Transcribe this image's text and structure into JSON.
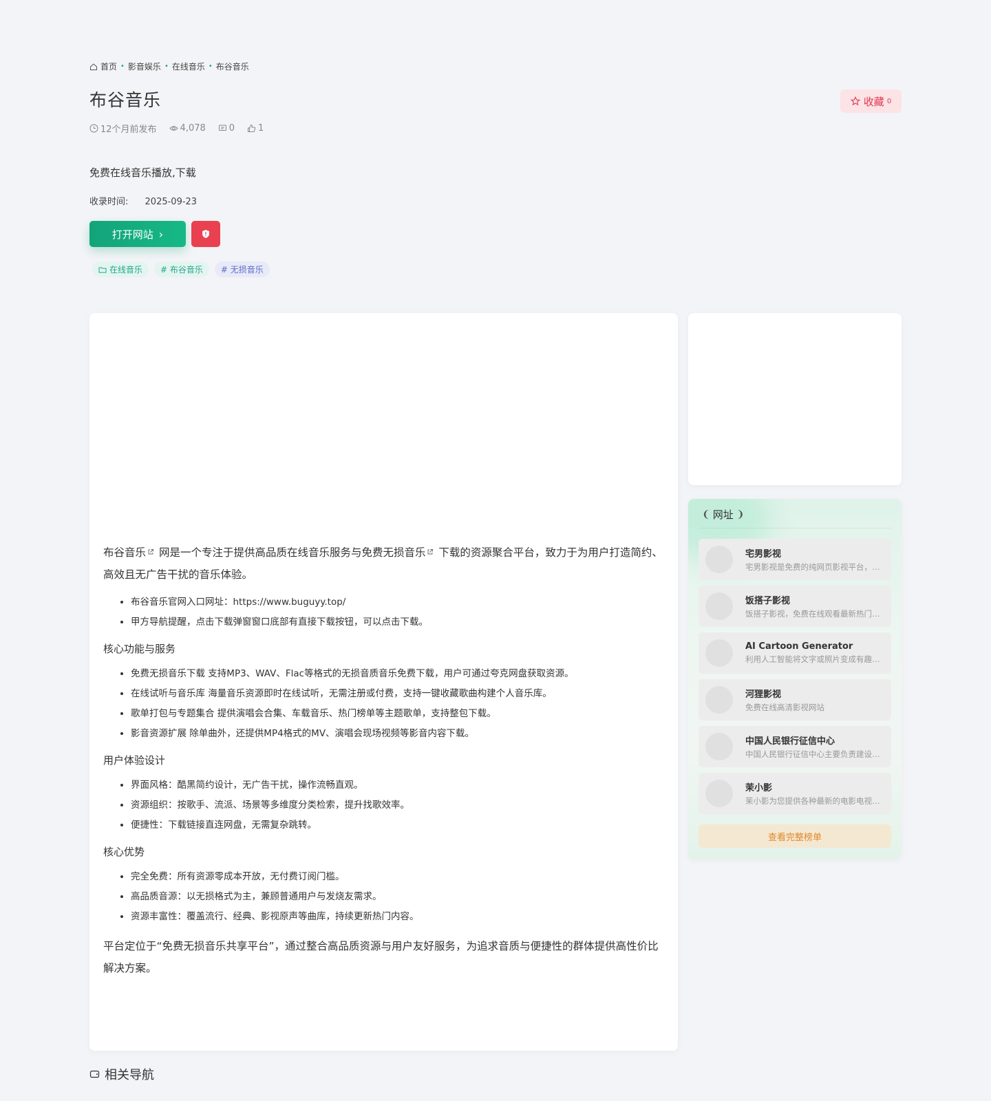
{
  "breadcrumb": {
    "items": [
      "首页",
      "影音娱乐",
      "在线音乐",
      "布谷音乐"
    ],
    "separator": "•"
  },
  "page": {
    "title": "布谷音乐",
    "favorite_label": "收藏",
    "favorite_count": "0",
    "meta": {
      "published": "12个月前发布",
      "views": "4,078",
      "comments": "0",
      "likes": "1"
    },
    "description": "免费在线音乐播放,下载",
    "record_label": "收录时间:",
    "record_date": "2025-09-23",
    "open_button": "打开网站",
    "tags": [
      {
        "label": "在线音乐",
        "icon": "folder-icon"
      },
      {
        "label": "# 布谷音乐",
        "icon": ""
      },
      {
        "label": "# 无损音乐",
        "icon": ""
      }
    ]
  },
  "content": {
    "lead_part1": "布谷音乐",
    "lead_part2": " 网是一个专注于提供高品质在线音乐服务与免费无损音乐",
    "lead_part3": " 下载的资源聚合平台，致力于为用户打造简约、高效且无广告干扰的音乐体验。",
    "intro_list": [
      "布谷音乐官网入口网址：https://www.buguyy.top/",
      "甲方导航提醒，点击下载弹窗窗口底部有直接下载按钮，可以点击下载。"
    ],
    "sections": [
      {
        "heading": "核心功能与服务",
        "items": [
          "免费无损音乐下载 支持MP3、WAV、Flac等格式的无损音质音乐免费下载，用户可通过夸克网盘获取资源。",
          "在线试听与音乐库 海量音乐资源即时在线试听，无需注册或付费，支持一键收藏歌曲构建个人音乐库。",
          "歌单打包与专题集合 提供演唱会合集、车载音乐、热门榜单等主题歌单，支持整包下载。",
          "影音资源扩展 除单曲外，还提供MP4格式的MV、演唱会现场视频等影音内容下载。"
        ]
      },
      {
        "heading": "用户体验设计",
        "items": [
          "界面风格：酷黑简约设计，无广告干扰，操作流畅直观。",
          "资源组织：按歌手、流派、场景等多维度分类检索，提升找歌效率。",
          "便捷性：下载链接直连网盘，无需复杂跳转。"
        ]
      },
      {
        "heading": "核心优势",
        "items": [
          "完全免费：所有资源零成本开放，无付费订阅门槛。",
          "高品质音源：以无损格式为主，兼顾普通用户与发烧友需求。",
          "资源丰富性：覆盖流行、经典、影视原声等曲库，持续更新热门内容。"
        ]
      }
    ],
    "closing": "平台定位于“免费无损音乐共享平台”，通过整合高品质资源与用户友好服务，为追求音质与便捷性的群体提供高性价比解决方案。"
  },
  "sidebar": {
    "title": "网址",
    "items": [
      {
        "name": "宅男影视",
        "sub": "宅男影视是免费的纯网页影视平台，提供"
      },
      {
        "name": "饭搭子影视",
        "sub": "饭搭子影视，免费在线观看最新热门影视"
      },
      {
        "name": "AI Cartoon Generator",
        "sub": "利用人工智能将文字或照片变成有趣的卡通"
      },
      {
        "name": "河狸影视",
        "sub": "免费在线高清影视网站"
      },
      {
        "name": "中国人民银行征信中心",
        "sub": "中国人民银行征信中心主要负责建设、运行"
      },
      {
        "name": "茉小影",
        "sub": "茉小影为您提供各种最新的电影电视剧在线"
      }
    ],
    "more_label": "查看完整榜单"
  },
  "related": {
    "title": "相关导航"
  },
  "colors": {
    "accent": "#14a97a",
    "danger": "#e9414f",
    "favorite_bg": "#fbe3e6",
    "more_text": "#e08a2a"
  }
}
